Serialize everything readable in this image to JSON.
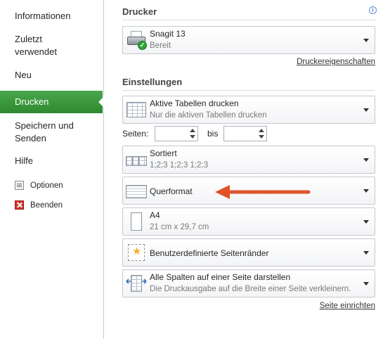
{
  "sidebar": {
    "items": [
      {
        "label": "Informationen"
      },
      {
        "label_line1": "Zuletzt",
        "label_line2": "verwendet"
      },
      {
        "label": "Neu"
      },
      {
        "label": "Drucken"
      },
      {
        "label_line1": "Speichern und",
        "label_line2": "Senden"
      },
      {
        "label": "Hilfe"
      }
    ],
    "options_label": "Optionen",
    "exit_label": "Beenden"
  },
  "printer": {
    "section_title": "Drucker",
    "name": "Snagit 13",
    "status": "Bereit",
    "properties_link": "Druckereigenschaften"
  },
  "settings": {
    "section_title": "Einstellungen",
    "print_what": {
      "title": "Aktive Tabellen drucken",
      "subtitle": "Nur die aktiven Tabellen drucken"
    },
    "pages_label": "Seiten:",
    "pages_from": "",
    "to_label": "bis",
    "pages_to": "",
    "collation": {
      "title": "Sortiert",
      "subtitle": "1;2;3    1;2;3    1;2;3"
    },
    "orientation": {
      "title": "Querformat"
    },
    "paper": {
      "title": "A4",
      "subtitle": "21  cm x 29,7  cm"
    },
    "margins": {
      "title": "Benutzerdefinierte Seitenränder"
    },
    "scaling": {
      "title": "Alle Spalten auf einer Seite darstellen",
      "subtitle": "Die Druckausgabe auf die Breite einer Seite verkleinern."
    },
    "page_setup_link": "Seite einrichten"
  },
  "colors": {
    "accent_green": "#2d8a2f",
    "annotation_arrow": "#e0532a"
  }
}
